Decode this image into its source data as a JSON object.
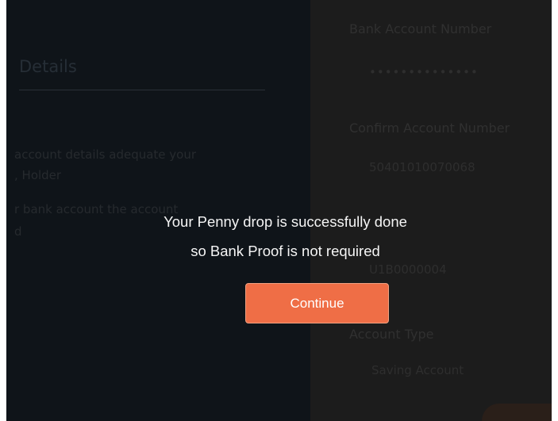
{
  "left": {
    "title": "Details",
    "description_lines": [
      "account details adequate your",
      ", Holder",
      "r bank account the account",
      "d"
    ]
  },
  "right": {
    "bank_account_number_label": "Bank Account Number",
    "bank_account_number_value": "••••••••••••••",
    "confirm_account_number_label": "Confirm Account Number",
    "confirm_account_number_value": "50401010070068",
    "ifsc_value": "U1B0000004",
    "account_type_label": "Account Type",
    "account_type_value": "Saving Account"
  },
  "modal": {
    "message_line1": "Your Penny drop is successfully done",
    "message_line2": "so Bank Proof is not required",
    "continue_label": "Continue"
  },
  "colors": {
    "accent": "#ef6e46",
    "overlay_left": "#0f1419",
    "overlay_right": "#1c1c1c"
  }
}
